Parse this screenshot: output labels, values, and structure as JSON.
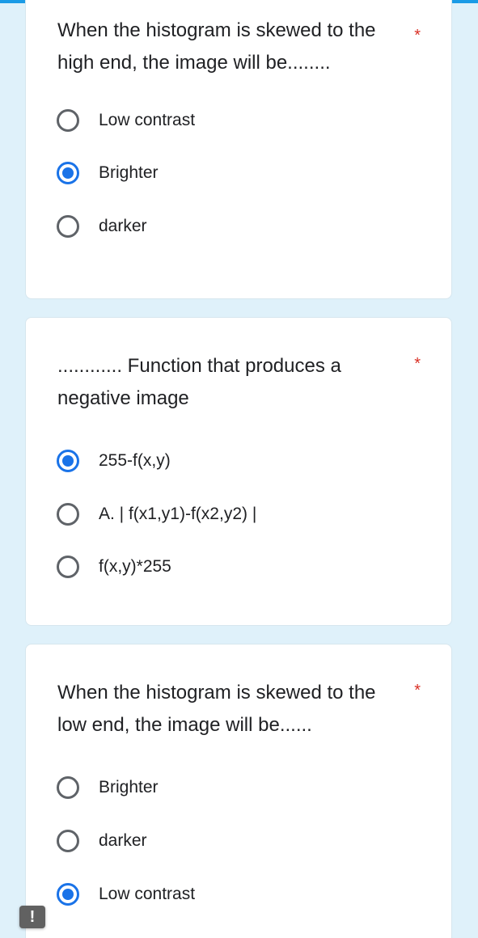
{
  "colors": {
    "background": "#dff1fa",
    "accent": "#1a73e8",
    "required": "#d93025",
    "text": "#202124"
  },
  "questions": [
    {
      "title": "When the histogram is skewed to the high end, the image will be........",
      "required_mark": "*",
      "options": [
        {
          "label": "Low contrast",
          "selected": false
        },
        {
          "label": "Brighter",
          "selected": true
        },
        {
          "label": "darker",
          "selected": false
        }
      ]
    },
    {
      "title": "............ Function that produces a negative image",
      "required_mark": "*",
      "options": [
        {
          "label": "255-f(x,y)",
          "selected": true
        },
        {
          "label": "A. | f(x1,y1)-f(x2,y2) |",
          "selected": false
        },
        {
          "label": "f(x,y)*255",
          "selected": false
        }
      ]
    },
    {
      "title": "When the histogram is skewed to the low end, the image will be......",
      "required_mark": "*",
      "options": [
        {
          "label": "Brighter",
          "selected": false
        },
        {
          "label": "darker",
          "selected": false
        },
        {
          "label": "Low contrast",
          "selected": true
        }
      ]
    }
  ],
  "report_button": {
    "label": "!",
    "icon": "exclamation-icon"
  }
}
